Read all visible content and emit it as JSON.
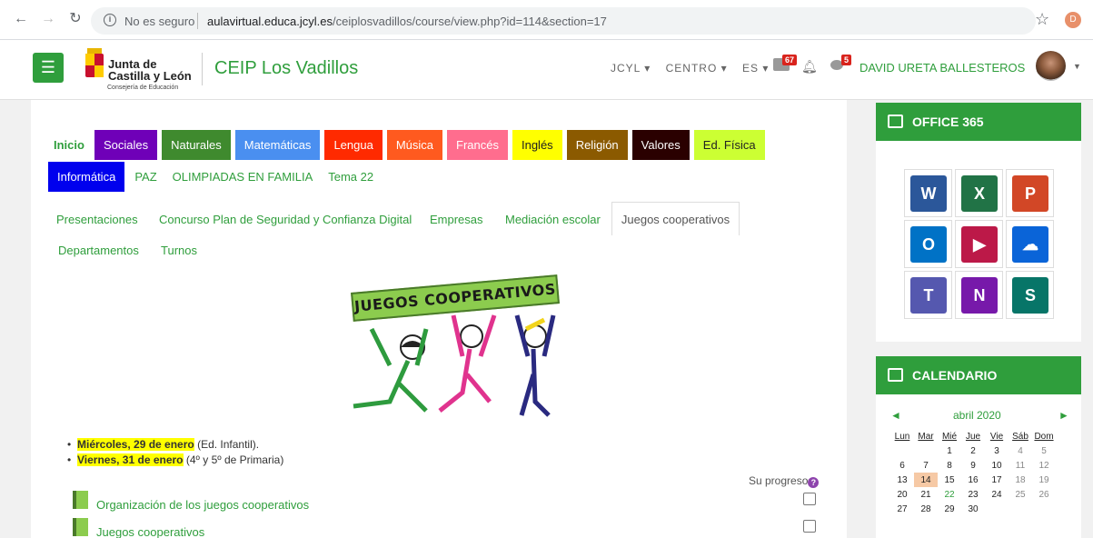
{
  "browser": {
    "security": "No es seguro",
    "url_domain": "aulavirtual.educa.jcyl.es",
    "url_path": "/ceiplosvadillos/course/view.php?id=114&section=17",
    "profile_initial": "D"
  },
  "navbar": {
    "logo_line1": "Junta de",
    "logo_line2": "Castilla y León",
    "logo_line3": "Consejería de Educación",
    "site_name": "CEIP Los Vadillos",
    "menus": [
      "JCYL ▾",
      "CENTRO ▾",
      "ES ▾"
    ],
    "messages_count": "67",
    "chat_count": "5",
    "user_name": "DAVID URETA BALLESTEROS"
  },
  "tabs_row1": [
    {
      "label": "Inicio",
      "bg": "#ffffff",
      "fg": "#2f9e3c"
    },
    {
      "label": "Sociales",
      "bg": "#6f00b8",
      "fg": "#ffffff"
    },
    {
      "label": "Naturales",
      "bg": "#3f8a2e",
      "fg": "#ffffff"
    },
    {
      "label": "Matemáticas",
      "bg": "#4a8ff0",
      "fg": "#ffffff"
    },
    {
      "label": "Lengua",
      "bg": "#ff2a00",
      "fg": "#ffffff"
    },
    {
      "label": "Música",
      "bg": "#ff5a1f",
      "fg": "#ffffff"
    },
    {
      "label": "Francés",
      "bg": "#ff6d8e",
      "fg": "#ffffff"
    },
    {
      "label": "Inglés",
      "bg": "#ffff00",
      "fg": "#222222"
    },
    {
      "label": "Religión",
      "bg": "#8b5a00",
      "fg": "#ffffff"
    },
    {
      "label": "Valores",
      "bg": "#2a0000",
      "fg": "#ffffff"
    },
    {
      "label": "Ed. Física",
      "bg": "#ccff33",
      "fg": "#222222"
    }
  ],
  "tabs_row2": [
    {
      "label": "Informática",
      "bg": "#0000ee",
      "fg": "#ffffff"
    },
    {
      "label": "PAZ",
      "bg": "#ffffff",
      "fg": "#2f9e3c"
    },
    {
      "label": "OLIMPIADAS EN FAMILIA",
      "bg": "#ffffff",
      "fg": "#2f9e3c"
    },
    {
      "label": "Tema 22",
      "bg": "#ffffff",
      "fg": "#2f9e3c"
    }
  ],
  "subtabs": {
    "presentaciones": "Presentaciones",
    "concurso": "Concurso Plan de Seguridad y Confianza Digital",
    "empresas": "Empresas",
    "mediacion": "Mediación escolar",
    "juegos": "Juegos cooperativos",
    "departamentos": "Departamentos",
    "turnos": "Turnos"
  },
  "banner_text": "JUEGOS COOPERATIVOS",
  "schedule": [
    {
      "date": "Miércoles, 29 de enero",
      "note": " (Ed. Infantil)."
    },
    {
      "date": "Viernes, 31 de enero",
      "note": " (4º y 5º de Primaria)"
    }
  ],
  "progress_label": "Su progreso",
  "activities": [
    "Organización de los juegos cooperativos",
    "Juegos cooperativos"
  ],
  "office": {
    "title": "OFFICE 365",
    "apps": [
      {
        "name": "word-icon",
        "letter": "W",
        "color": "#2b579a"
      },
      {
        "name": "excel-icon",
        "letter": "X",
        "color": "#217346"
      },
      {
        "name": "powerpoint-icon",
        "letter": "P",
        "color": "#d24726"
      },
      {
        "name": "outlook-icon",
        "letter": "O",
        "color": "#0072c6"
      },
      {
        "name": "stream-icon",
        "letter": "▶",
        "color": "#bc1948"
      },
      {
        "name": "onedrive-icon",
        "letter": "☁",
        "color": "#0a64d8"
      },
      {
        "name": "teams-icon",
        "letter": "T",
        "color": "#5558af"
      },
      {
        "name": "onenote-icon",
        "letter": "N",
        "color": "#7719aa"
      },
      {
        "name": "sway-icon",
        "letter": "S",
        "color": "#077568"
      }
    ]
  },
  "calendar": {
    "title": "CALENDARIO",
    "month": "abril 2020",
    "prev": "◄",
    "next": "►",
    "weekdays": [
      "Lun",
      "Mar",
      "Mié",
      "Jue",
      "Vie",
      "Sáb",
      "Dom"
    ],
    "weeks": [
      [
        "",
        "",
        "1",
        "2",
        "3",
        "4",
        "5"
      ],
      [
        "6",
        "7",
        "8",
        "9",
        "10",
        "11",
        "12"
      ],
      [
        "13",
        "14",
        "15",
        "16",
        "17",
        "18",
        "19"
      ],
      [
        "20",
        "21",
        "22",
        "23",
        "24",
        "25",
        "26"
      ],
      [
        "27",
        "28",
        "29",
        "30",
        "",
        "",
        ""
      ]
    ],
    "today": "14",
    "event_day": "22"
  }
}
